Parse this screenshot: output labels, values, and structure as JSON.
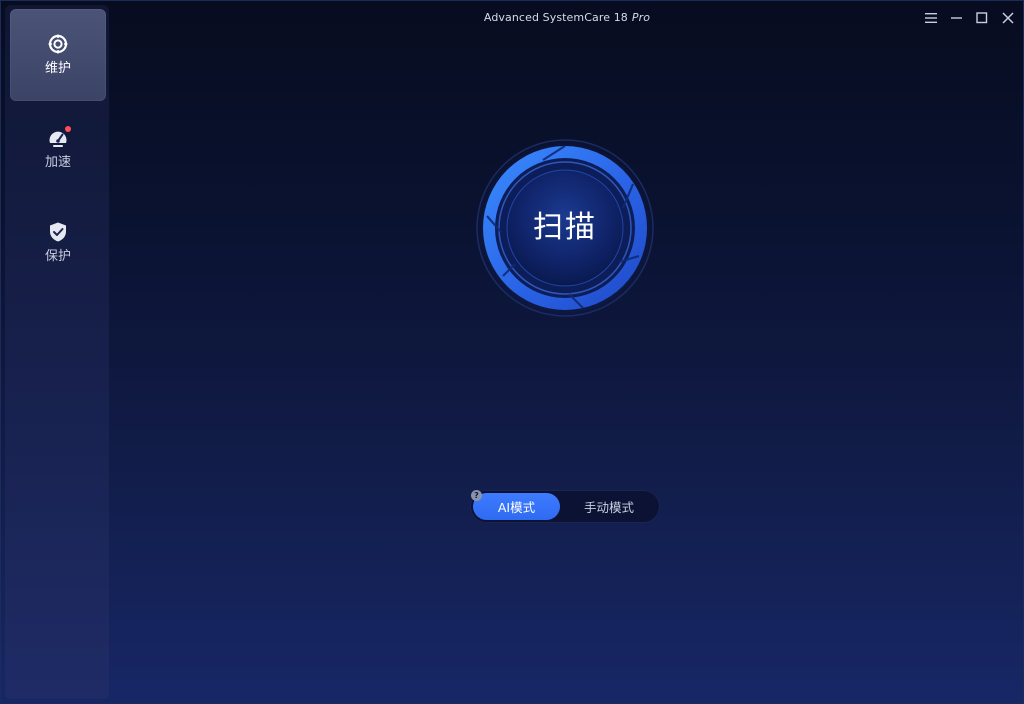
{
  "app": {
    "title": "Advanced SystemCare 18",
    "edition": "Pro"
  },
  "sidebar": {
    "items": [
      {
        "label": "维护",
        "icon": "maintain-icon",
        "active": true
      },
      {
        "label": "加速",
        "icon": "speedometer-icon",
        "active": false,
        "badge": "notification-dot"
      },
      {
        "label": "保护",
        "icon": "shield-icon",
        "active": false
      }
    ]
  },
  "window_controls": [
    "menu-icon",
    "minimize-icon",
    "maximize-icon",
    "close-icon"
  ],
  "scan": {
    "label": "扫描"
  },
  "mode": {
    "help": "?",
    "options": [
      "AI模式",
      "手动模式"
    ],
    "selected": "AI模式"
  },
  "colors": {
    "accent": "#3d7bff",
    "badge_red": "#ff4d57",
    "sidebar_active": "#4b5376"
  }
}
